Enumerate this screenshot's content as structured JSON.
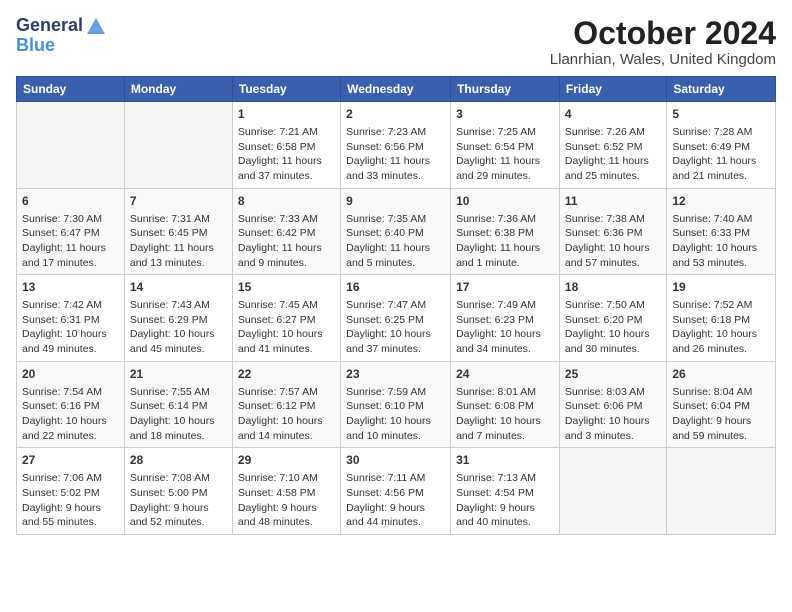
{
  "header": {
    "logo_line1": "General",
    "logo_line2": "Blue",
    "month_year": "October 2024",
    "location": "Llanrhian, Wales, United Kingdom"
  },
  "weekdays": [
    "Sunday",
    "Monday",
    "Tuesday",
    "Wednesday",
    "Thursday",
    "Friday",
    "Saturday"
  ],
  "weeks": [
    [
      {
        "day": "",
        "empty": true
      },
      {
        "day": "",
        "empty": true
      },
      {
        "day": "1",
        "sunrise": "7:21 AM",
        "sunset": "6:58 PM",
        "daylight": "11 hours and 37 minutes."
      },
      {
        "day": "2",
        "sunrise": "7:23 AM",
        "sunset": "6:56 PM",
        "daylight": "11 hours and 33 minutes."
      },
      {
        "day": "3",
        "sunrise": "7:25 AM",
        "sunset": "6:54 PM",
        "daylight": "11 hours and 29 minutes."
      },
      {
        "day": "4",
        "sunrise": "7:26 AM",
        "sunset": "6:52 PM",
        "daylight": "11 hours and 25 minutes."
      },
      {
        "day": "5",
        "sunrise": "7:28 AM",
        "sunset": "6:49 PM",
        "daylight": "11 hours and 21 minutes."
      }
    ],
    [
      {
        "day": "6",
        "sunrise": "7:30 AM",
        "sunset": "6:47 PM",
        "daylight": "11 hours and 17 minutes."
      },
      {
        "day": "7",
        "sunrise": "7:31 AM",
        "sunset": "6:45 PM",
        "daylight": "11 hours and 13 minutes."
      },
      {
        "day": "8",
        "sunrise": "7:33 AM",
        "sunset": "6:42 PM",
        "daylight": "11 hours and 9 minutes."
      },
      {
        "day": "9",
        "sunrise": "7:35 AM",
        "sunset": "6:40 PM",
        "daylight": "11 hours and 5 minutes."
      },
      {
        "day": "10",
        "sunrise": "7:36 AM",
        "sunset": "6:38 PM",
        "daylight": "11 hours and 1 minute."
      },
      {
        "day": "11",
        "sunrise": "7:38 AM",
        "sunset": "6:36 PM",
        "daylight": "10 hours and 57 minutes."
      },
      {
        "day": "12",
        "sunrise": "7:40 AM",
        "sunset": "6:33 PM",
        "daylight": "10 hours and 53 minutes."
      }
    ],
    [
      {
        "day": "13",
        "sunrise": "7:42 AM",
        "sunset": "6:31 PM",
        "daylight": "10 hours and 49 minutes."
      },
      {
        "day": "14",
        "sunrise": "7:43 AM",
        "sunset": "6:29 PM",
        "daylight": "10 hours and 45 minutes."
      },
      {
        "day": "15",
        "sunrise": "7:45 AM",
        "sunset": "6:27 PM",
        "daylight": "10 hours and 41 minutes."
      },
      {
        "day": "16",
        "sunrise": "7:47 AM",
        "sunset": "6:25 PM",
        "daylight": "10 hours and 37 minutes."
      },
      {
        "day": "17",
        "sunrise": "7:49 AM",
        "sunset": "6:23 PM",
        "daylight": "10 hours and 34 minutes."
      },
      {
        "day": "18",
        "sunrise": "7:50 AM",
        "sunset": "6:20 PM",
        "daylight": "10 hours and 30 minutes."
      },
      {
        "day": "19",
        "sunrise": "7:52 AM",
        "sunset": "6:18 PM",
        "daylight": "10 hours and 26 minutes."
      }
    ],
    [
      {
        "day": "20",
        "sunrise": "7:54 AM",
        "sunset": "6:16 PM",
        "daylight": "10 hours and 22 minutes."
      },
      {
        "day": "21",
        "sunrise": "7:55 AM",
        "sunset": "6:14 PM",
        "daylight": "10 hours and 18 minutes."
      },
      {
        "day": "22",
        "sunrise": "7:57 AM",
        "sunset": "6:12 PM",
        "daylight": "10 hours and 14 minutes."
      },
      {
        "day": "23",
        "sunrise": "7:59 AM",
        "sunset": "6:10 PM",
        "daylight": "10 hours and 10 minutes."
      },
      {
        "day": "24",
        "sunrise": "8:01 AM",
        "sunset": "6:08 PM",
        "daylight": "10 hours and 7 minutes."
      },
      {
        "day": "25",
        "sunrise": "8:03 AM",
        "sunset": "6:06 PM",
        "daylight": "10 hours and 3 minutes."
      },
      {
        "day": "26",
        "sunrise": "8:04 AM",
        "sunset": "6:04 PM",
        "daylight": "9 hours and 59 minutes."
      }
    ],
    [
      {
        "day": "27",
        "sunrise": "7:06 AM",
        "sunset": "5:02 PM",
        "daylight": "9 hours and 55 minutes."
      },
      {
        "day": "28",
        "sunrise": "7:08 AM",
        "sunset": "5:00 PM",
        "daylight": "9 hours and 52 minutes."
      },
      {
        "day": "29",
        "sunrise": "7:10 AM",
        "sunset": "4:58 PM",
        "daylight": "9 hours and 48 minutes."
      },
      {
        "day": "30",
        "sunrise": "7:11 AM",
        "sunset": "4:56 PM",
        "daylight": "9 hours and 44 minutes."
      },
      {
        "day": "31",
        "sunrise": "7:13 AM",
        "sunset": "4:54 PM",
        "daylight": "9 hours and 40 minutes."
      },
      {
        "day": "",
        "empty": true
      },
      {
        "day": "",
        "empty": true
      }
    ]
  ],
  "labels": {
    "sunrise": "Sunrise:",
    "sunset": "Sunset:",
    "daylight": "Daylight hours"
  }
}
